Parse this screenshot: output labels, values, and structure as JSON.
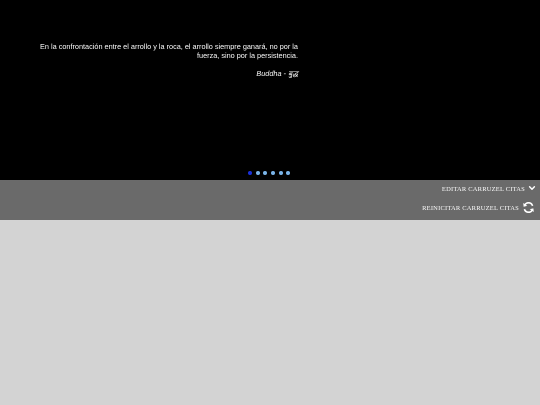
{
  "carousel": {
    "quote": "En la confrontación entre el arrollo y la roca, el arrollo siempre ganará, no por la fuerza, sino por la persistencia.",
    "author": "Buddha - बुद्ध",
    "dots": 6,
    "active_index": 0
  },
  "controls": {
    "edit_label": "EDITAR CARRUZEL CITAS",
    "reset_label": "REINICITAR CARRUZEL CITAS"
  },
  "icons": {
    "edit": "chevron-down-icon",
    "reset": "refresh-icon"
  },
  "colors": {
    "carousel_bg": "#000000",
    "controls_bg": "#6a6a6a",
    "page_bg": "#d3d3d3",
    "dot": "#7ab4e8",
    "dot_active": "#1a2fd8"
  }
}
